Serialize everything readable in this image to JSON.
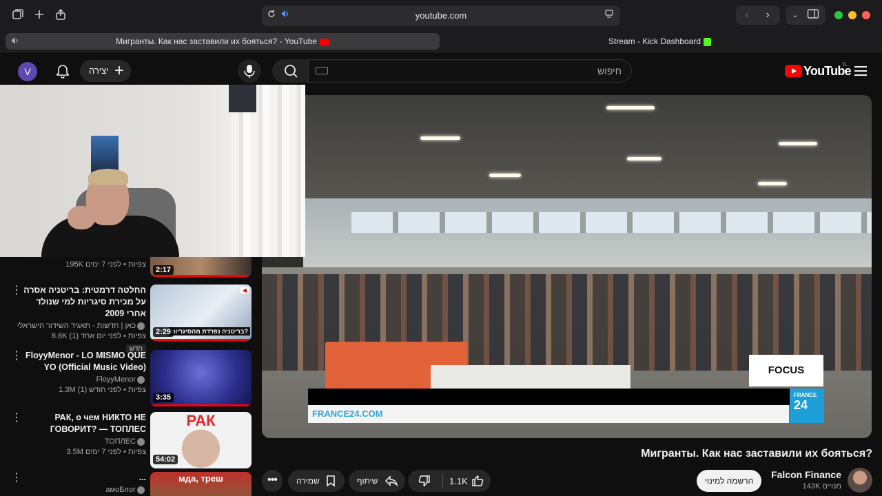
{
  "browser": {
    "url": "youtube.com",
    "tabs": [
      {
        "label": "Мигранты. Как нас заставили их бояться? - YouTube",
        "favicon": "youtube-favicon"
      },
      {
        "label": "Stream - Kick Dashboard",
        "favicon": "kick-favicon"
      }
    ],
    "window_buttons": {
      "close": "#ff5f57",
      "minimize": "#febc2e",
      "maximize": "#28c840"
    }
  },
  "header": {
    "avatar_letter": "V",
    "create_label": "יצירה",
    "search_placeholder": "חיפוש",
    "logo_text": "YouTube",
    "country_code": "IL"
  },
  "related": [
    {
      "title": "",
      "channel": "",
      "meta": "195K צפיות • לפני 7 ימים",
      "duration": "2:17",
      "short": true
    },
    {
      "title": "החלטה דרמטית: בריטניה אסרה על מכירת סיגריות למי שנולד אחרי 2009",
      "channel": "כאן | חדשות - תאגיד השידור הישראלי",
      "meta": "8.8K צפיות • לפני יום אחד (1)",
      "badge": "חדש",
      "duration": "2:29",
      "thumb_caption": "בריטניה נפרדת מהסיגריות?",
      "short": true
    },
    {
      "title": "FloyyMenor - LO MISMO QUE YO (Official Music Video)",
      "channel": "FloyyMenor",
      "meta": "1.3M צפיות • לפני חודש (1)",
      "duration": "3:35",
      "short": true
    },
    {
      "title": "РАК, о чем НИКТО НЕ ГОВОРИТ? — ТОПЛЕС",
      "channel": "ТОПЛЕС",
      "meta": "3.5M צפיות • לפני 7 ימים",
      "duration": "54:02",
      "thumb_caption": "РАК"
    },
    {
      "title": "...",
      "channel": "амоБлог",
      "meta": "",
      "thumb_caption": "мда, треш"
    }
  ],
  "player": {
    "focus_label": "FOCUS",
    "ticker_url": "FRANCE24.COM",
    "logo_line1": "FRANCE",
    "logo_line2": "24"
  },
  "video": {
    "title": "Мигранты. Как нас заставили их бояться?",
    "likes": "1.1K",
    "share_label": "שיתוף",
    "save_label": "שמירה",
    "subscribe_label": "הרשמה למינוי",
    "channel_name": "Falcon Finance",
    "channel_subs": "143K מנויים"
  }
}
